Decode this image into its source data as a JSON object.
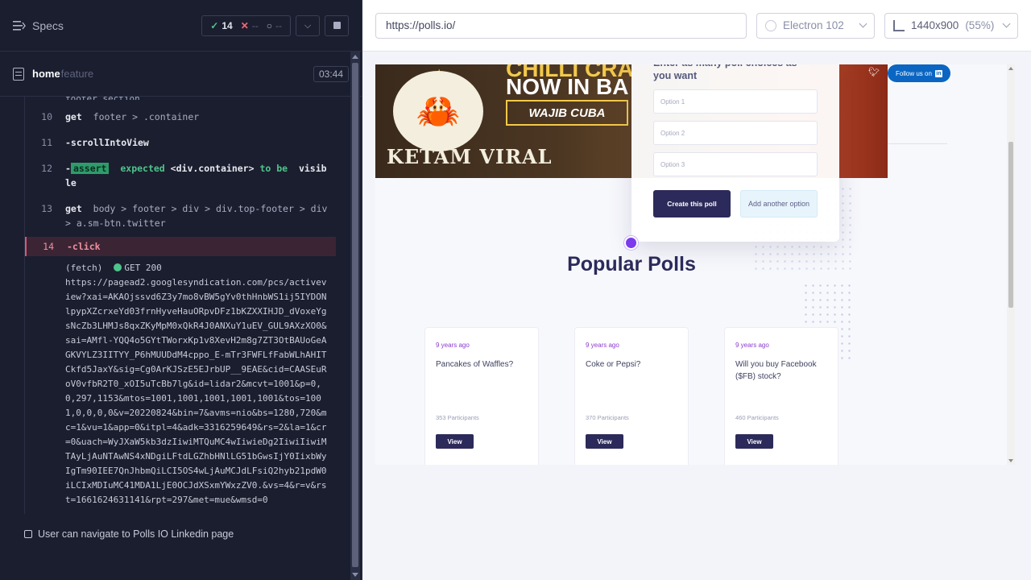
{
  "reporter": {
    "specs_label": "Specs",
    "stats": {
      "passed": "14",
      "failed": "--",
      "pending": "--"
    },
    "spec": {
      "name": "home",
      "ext": "feature",
      "duration": "03:44"
    },
    "commands": [
      {
        "num": "10",
        "name": "get",
        "arg": "footer > .container"
      },
      {
        "num": "11",
        "name": "-scrollIntoView",
        "arg": ""
      },
      {
        "num": "12",
        "assert": "assert",
        "text1": "expected",
        "subject": "<div.container>",
        "text2": "to be",
        "text3": "visible"
      },
      {
        "num": "13",
        "name": "get",
        "arg": "body > footer > div > div.top-footer > div > a.sm-btn.twitter"
      },
      {
        "num": "14",
        "name": "-click",
        "arg": ""
      }
    ],
    "fetch": {
      "label": "(fetch)",
      "status": "GET 200",
      "url": "https://pagead2.googlesyndication.com/pcs/activeview?xai=AKAOjssvd6Z3y7mo8vBW5gYv0thHnbWS1ij5IYDONlpypXZcrxeYd03frnHyveHauORpvDFz1bKZXXIHJD_dVoxeYgsNcZb3LHMJs8qxZKyMpM0xQkR4J0ANXuY1uEV_GUL9AXzXO0&sai=AMfl-YQQ4o5GYtTWorxKp1v8XevH2m8g7ZT3OtBAUoGeAGKVYLZ3IITYY_P6hMUUDdM4cppo_E-mTr3FWFLfFabWLhAHITCkfd5JaxY&sig=Cg0ArKJSzE5EJrbUP__9EAE&cid=CAASEuRoV0vfbR2T0_xOI5uTcBb7lg&id=lidar2&mcvt=1001&p=0,0,297,1153&mtos=1001,1001,1001,1001,1001&tos=1001,0,0,0,0&v=20220824&bin=7&avms=nio&bs=1280,720&mc=1&vu=1&app=0&itpl=4&adk=3316259649&rs=2&la=1&cr=0&uach=WyJXaW5kb3dzIiwiMTQuMC4wIiwieDg2IiwiIiwiMTAyLjAuNTAwNS4xNDgiLFtdLGZhbHNlLG51bGwsIjY0IixbWyIgTm90IEE7QnJhbmQiLCI5OS4wLjAuMCJdLFsiQ2hyb21pdW0iLCIxMDIuMC41MDA1LjE0OCJdXSxmYWxzZV0.&vs=4&r=v&rst=1661624631141&rpt=297&met=mue&wmsd=0"
    },
    "next_test": "User can navigate to Polls IO Linkedin page"
  },
  "toolbar": {
    "url": "https://polls.io/",
    "browser": "Electron 102",
    "viewport": "1440x900",
    "zoom": "(55%)"
  },
  "page": {
    "banner": {
      "headline_1": "CHILLI CRA",
      "headline_2": "NOW IN BA",
      "cta": "WAJIB CUBA",
      "brand": "KETAM VIRAL"
    },
    "follow_label": "Follow us on",
    "poll_form": {
      "title": "Enter as many poll choices as you want",
      "options": [
        "Option 1",
        "Option 2",
        "Option 3"
      ],
      "create_label": "Create this poll",
      "add_label": "Add another option"
    },
    "section_title": "Popular Polls",
    "polls": [
      {
        "time": "9 years ago",
        "question": "Pancakes of Waffles?",
        "participants": "353 Participants",
        "view": "View"
      },
      {
        "time": "9 years ago",
        "question": "Coke or Pepsi?",
        "participants": "370 Participants",
        "view": "View"
      },
      {
        "time": "9 years ago",
        "question": "Will you buy Facebook ($FB) stock?",
        "participants": "460 Participants",
        "view": "View"
      }
    ]
  }
}
